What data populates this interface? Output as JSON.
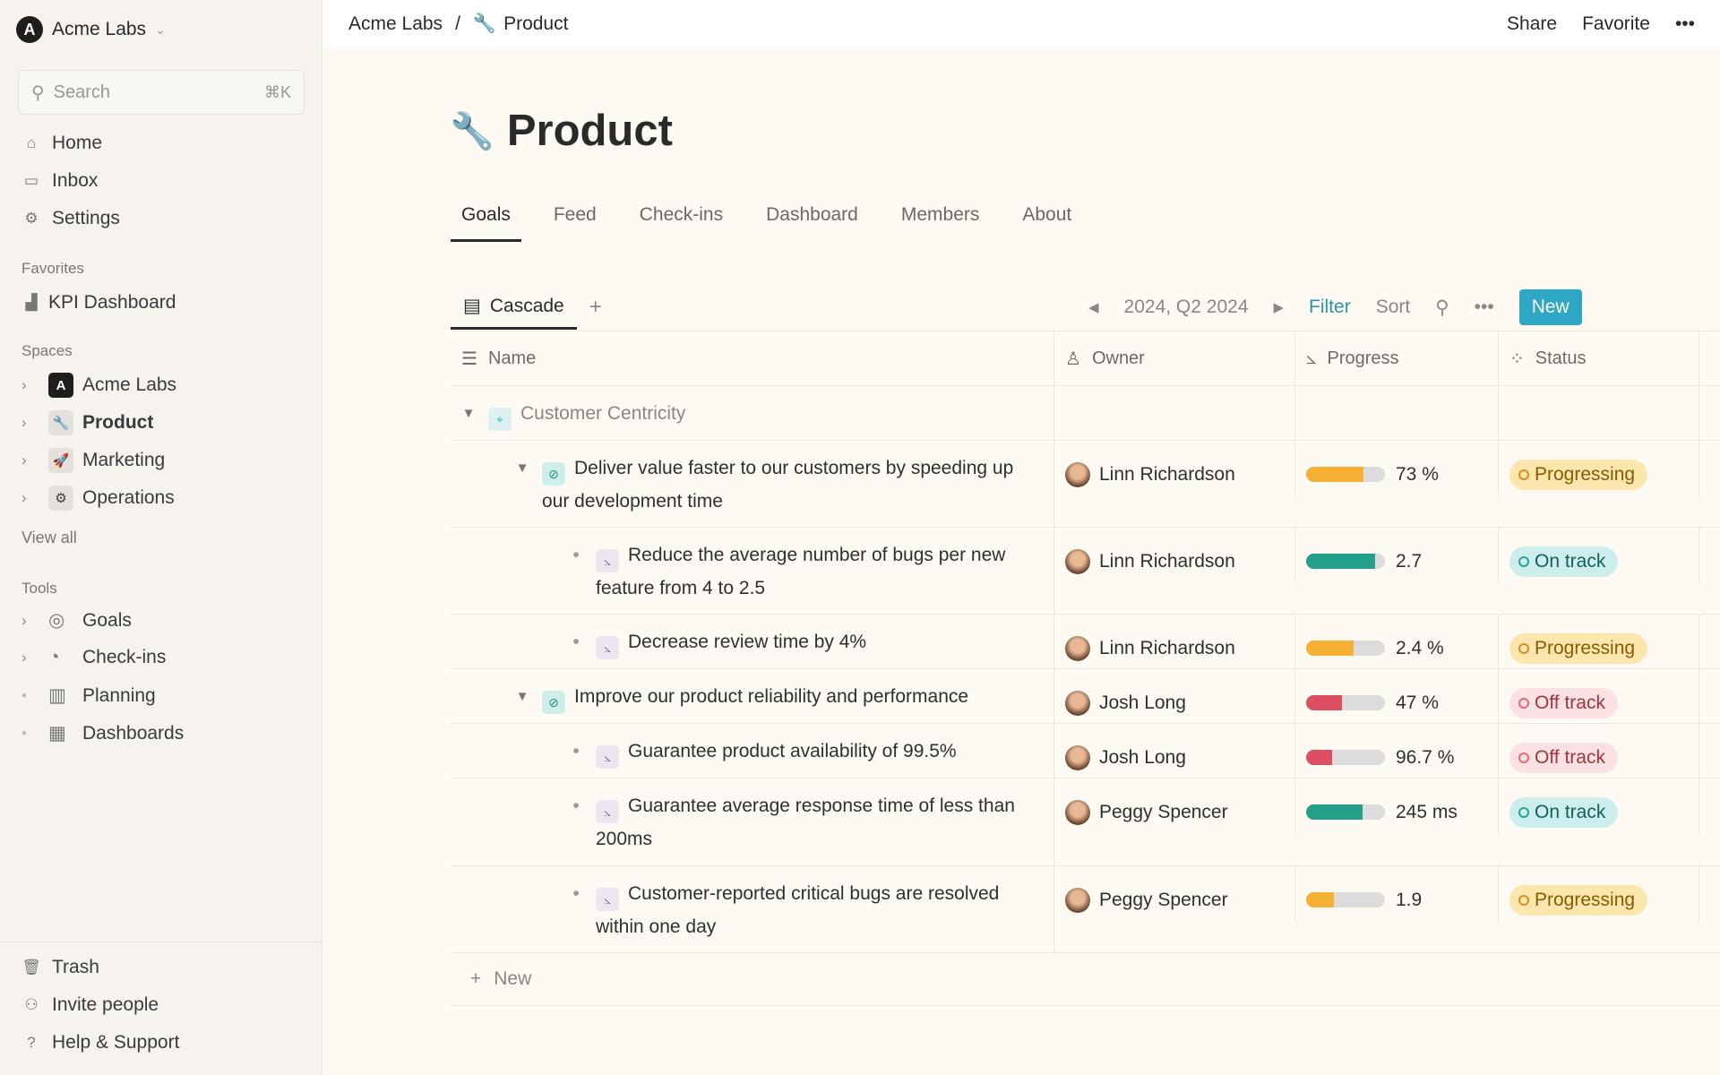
{
  "sidebar": {
    "workspace": "Acme Labs",
    "search_placeholder": "Search",
    "search_shortcut": "⌘K",
    "nav": [
      {
        "label": "Home",
        "icon": "home-icon"
      },
      {
        "label": "Inbox",
        "icon": "inbox-icon"
      },
      {
        "label": "Settings",
        "icon": "gear-icon"
      }
    ],
    "favorites_title": "Favorites",
    "favorites": [
      {
        "label": "KPI Dashboard",
        "icon": "chart-icon"
      }
    ],
    "spaces_title": "Spaces",
    "spaces": [
      {
        "label": "Acme Labs",
        "icon": "acme-logo-icon"
      },
      {
        "label": "Product",
        "icon": "wrench-icon",
        "active": true
      },
      {
        "label": "Marketing",
        "icon": "rocket-icon"
      },
      {
        "label": "Operations",
        "icon": "gear-icon"
      }
    ],
    "view_all": "View all",
    "tools_title": "Tools",
    "tools": [
      {
        "label": "Goals",
        "icon": "compass-icon"
      },
      {
        "label": "Check-ins",
        "icon": "clock-icon"
      },
      {
        "label": "Planning",
        "icon": "map-icon"
      },
      {
        "label": "Dashboards",
        "icon": "grid-icon"
      }
    ],
    "bottom": [
      {
        "label": "Trash",
        "icon": "trash-icon"
      },
      {
        "label": "Invite people",
        "icon": "invite-icon"
      },
      {
        "label": "Help & Support",
        "icon": "help-icon"
      }
    ]
  },
  "breadcrumb": {
    "root": "Acme Labs",
    "separator": "/",
    "current": "Product"
  },
  "header_actions": {
    "share": "Share",
    "favorite": "Favorite",
    "more": "•••"
  },
  "page": {
    "title": "Product",
    "icon": "wrench-icon"
  },
  "tabs": [
    "Goals",
    "Feed",
    "Check-ins",
    "Dashboard",
    "Members",
    "About"
  ],
  "active_tab": "Goals",
  "toolbar": {
    "view": "Cascade",
    "add": "+",
    "period": "2024, Q2 2024",
    "filter": "Filter",
    "sort": "Sort",
    "more": "•••",
    "new": "New"
  },
  "colors": {
    "accent": "#2ea7c4",
    "orange": "#f5b035",
    "green": "#22a08a",
    "red": "#dc4f63"
  },
  "columns": [
    "Name",
    "Owner",
    "Progress",
    "Status"
  ],
  "rows": [
    {
      "level": 0,
      "name": "Customer Centricity",
      "type": "objective"
    },
    {
      "level": 1,
      "name": "Deliver value faster to our customers by speeding up our development time",
      "type": "goal",
      "owner": "Linn Richardson",
      "progress": 0.73,
      "value": "73 %",
      "color": "orange",
      "status": "Progressing"
    },
    {
      "level": 2,
      "name": "Reduce the average number of bugs per new feature from 4 to 2.5",
      "type": "kpi",
      "owner": "Linn Richardson",
      "progress": 0.87,
      "value": "2.7",
      "color": "green",
      "status": "On track"
    },
    {
      "level": 2,
      "name": "Decrease review time by 4%",
      "type": "kpi",
      "owner": "Linn Richardson",
      "progress": 0.6,
      "value": "2.4 %",
      "color": "orange",
      "status": "Progressing"
    },
    {
      "level": 1,
      "name": "Improve our product reliability and performance",
      "type": "goal",
      "owner": "Josh Long",
      "progress": 0.45,
      "value": "47 %",
      "color": "red",
      "status": "Off track"
    },
    {
      "level": 2,
      "name": "Guarantee product availability of 99.5%",
      "type": "kpi",
      "owner": "Josh Long",
      "progress": 0.33,
      "value": "96.7 %",
      "color": "red",
      "status": "Off track"
    },
    {
      "level": 2,
      "name": "Guarantee average response time of less than 200ms",
      "type": "kpi",
      "owner": "Peggy Spencer",
      "progress": 0.72,
      "value": "245 ms",
      "color": "green",
      "status": "On track"
    },
    {
      "level": 2,
      "name": "Customer-reported critical bugs are resolved within one day",
      "type": "kpi",
      "owner": "Peggy Spencer",
      "progress": 0.35,
      "value": "1.9",
      "color": "orange",
      "status": "Progressing"
    }
  ],
  "new_row": "New"
}
